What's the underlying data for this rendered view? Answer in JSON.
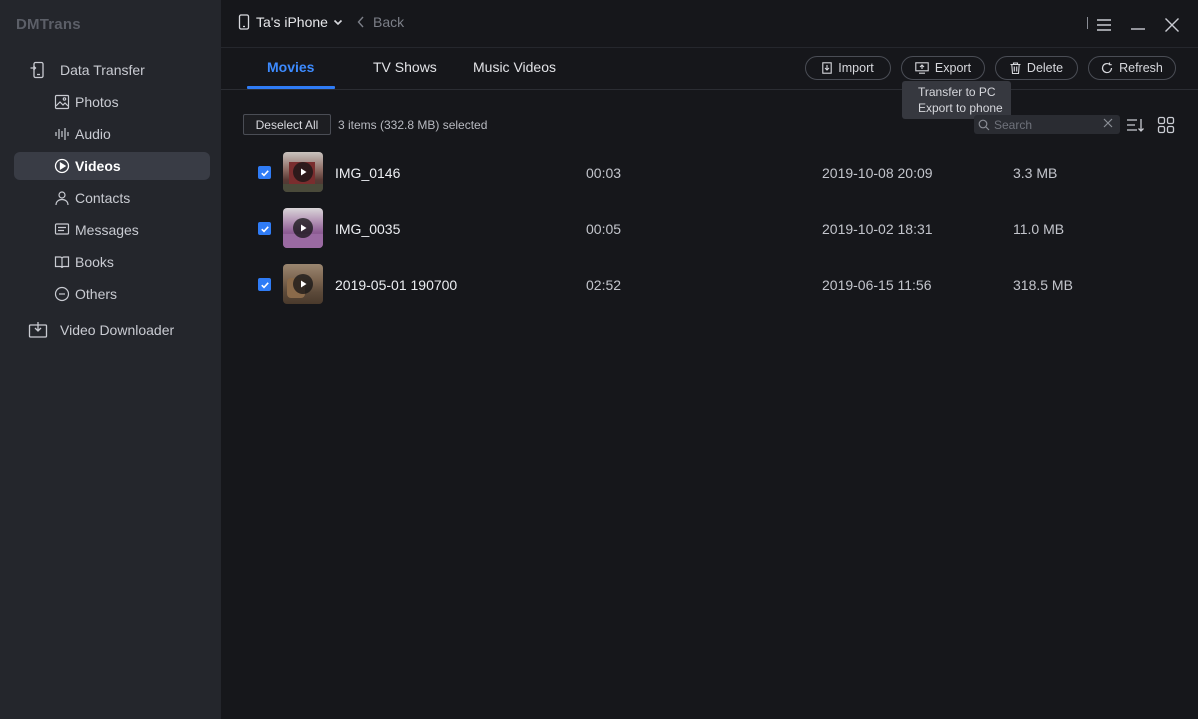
{
  "app": {
    "title": "DMTrans"
  },
  "sidebar": {
    "sections": [
      {
        "label": "Data Transfer",
        "icon": "phone-transfer-icon"
      },
      {
        "label": "Video Downloader",
        "icon": "download-icon"
      }
    ],
    "items": [
      {
        "label": "Photos",
        "icon": "image-icon"
      },
      {
        "label": "Audio",
        "icon": "audio-wave-icon"
      },
      {
        "label": "Videos",
        "icon": "play-circle-icon",
        "active": true
      },
      {
        "label": "Contacts",
        "icon": "person-icon"
      },
      {
        "label": "Messages",
        "icon": "message-icon"
      },
      {
        "label": "Books",
        "icon": "book-icon"
      },
      {
        "label": "Others",
        "icon": "ellipsis-circle-icon"
      }
    ]
  },
  "header": {
    "device": "Ta's iPhone",
    "back": "Back"
  },
  "tabs": [
    {
      "label": "Movies",
      "active": true
    },
    {
      "label": "TV Shows"
    },
    {
      "label": "Music Videos"
    }
  ],
  "actions": {
    "import": "Import",
    "export": "Export",
    "delete": "Delete",
    "refresh": "Refresh"
  },
  "tooltip": {
    "items": [
      "Transfer to PC",
      "Export to phone"
    ]
  },
  "toolbar": {
    "deselect": "Deselect All",
    "selection": "3 items (332.8 MB) selected",
    "search_placeholder": "Search"
  },
  "videos": [
    {
      "name": "IMG_0146",
      "duration": "00:03",
      "date": "2019-10-08 20:09",
      "size": "3.3 MB",
      "checked": true
    },
    {
      "name": "IMG_0035",
      "duration": "00:05",
      "date": "2019-10-02 18:31",
      "size": "11.0 MB",
      "checked": true
    },
    {
      "name": "2019-05-01 190700",
      "duration": "02:52",
      "date": "2019-06-15 11:56",
      "size": "318.5 MB",
      "checked": true
    }
  ],
  "colors": {
    "accent": "#2f7cf6",
    "active_tab": "#3d8bff",
    "sidebar_bg": "#24262c",
    "main_bg": "#16171b"
  }
}
